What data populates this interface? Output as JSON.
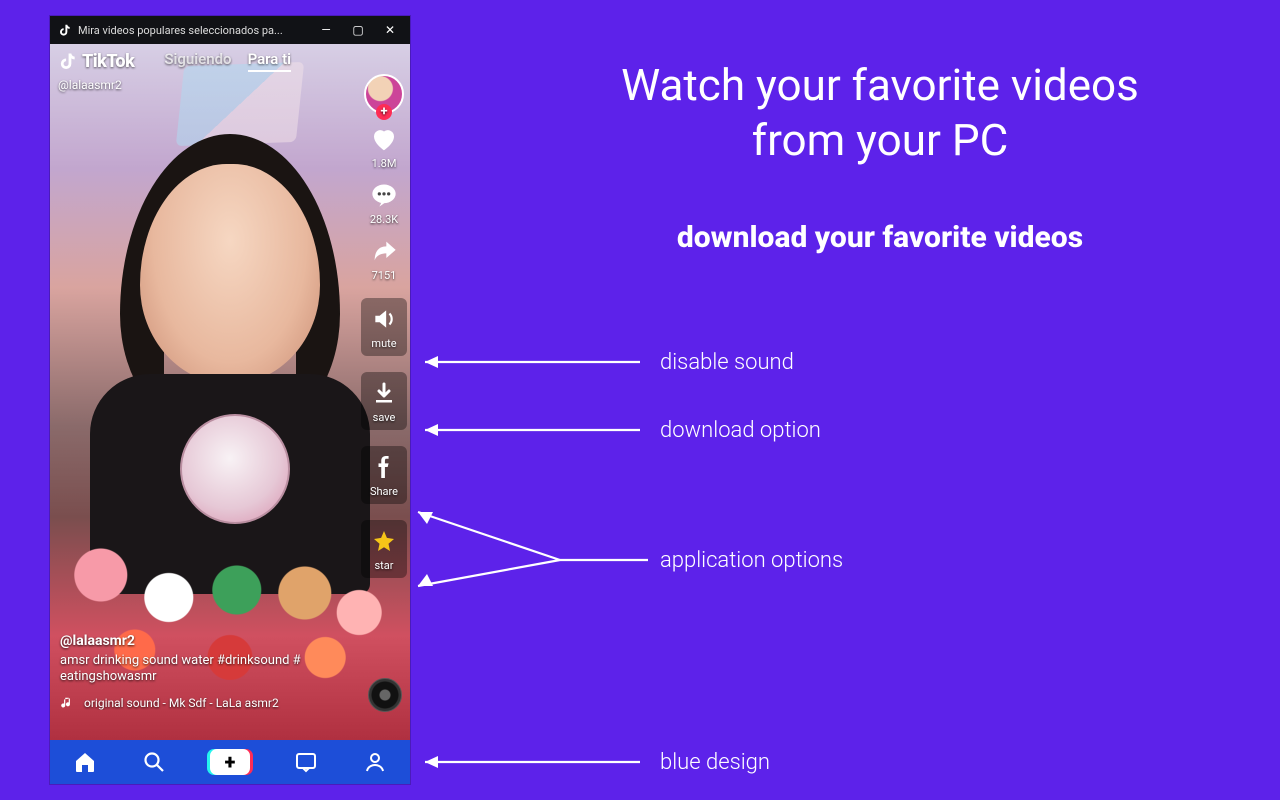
{
  "titlebar": {
    "title": "Mira videos populares seleccionados pa...",
    "min": "—",
    "max": "▢",
    "close": "✕"
  },
  "app": {
    "logo_text": "TikTok",
    "tab_following": "Siguiendo",
    "tab_for_you": "Para ti",
    "handle": "@lalaasmr2"
  },
  "rail": {
    "likes": "1.8M",
    "comments": "28.3K",
    "shares": "7151",
    "mute": "mute",
    "save": "save",
    "share_fb": "Share",
    "star": "star"
  },
  "caption": {
    "user": "@lalaasmr2",
    "desc": "amsr drinking sound water #drinksound # eatingshowasmr",
    "sound": "original sound - Mk Sdf - LaLa asmr2"
  },
  "marketing": {
    "headline_l1": "Watch your favorite videos",
    "headline_l2": "from your PC",
    "sub": "download your favorite videos",
    "annot_mute": "disable sound",
    "annot_download": "download option",
    "annot_options": "application options",
    "annot_blue": "blue design"
  }
}
